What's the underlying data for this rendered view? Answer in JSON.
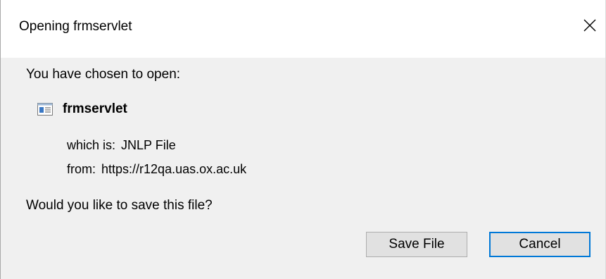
{
  "window": {
    "title": "Opening frmservlet",
    "close_icon": "close-icon"
  },
  "content": {
    "open_prompt": "You have chosen to open:",
    "file": {
      "icon": "jnlp-file-icon",
      "name": "frmservlet",
      "type_label": "which is:",
      "type_value": "JNLP File",
      "from_label": "from:",
      "from_value": "https://r12qa.uas.ox.ac.uk"
    },
    "save_prompt": "Would you like to save this file?"
  },
  "buttons": {
    "save_label": "Save File",
    "cancel_label": "Cancel"
  },
  "colors": {
    "titlebar_bg": "#ffffff",
    "body_bg": "#f0f0f0",
    "button_bg": "#e1e1e1",
    "button_border": "#adadad",
    "focus_border": "#0078d7"
  }
}
